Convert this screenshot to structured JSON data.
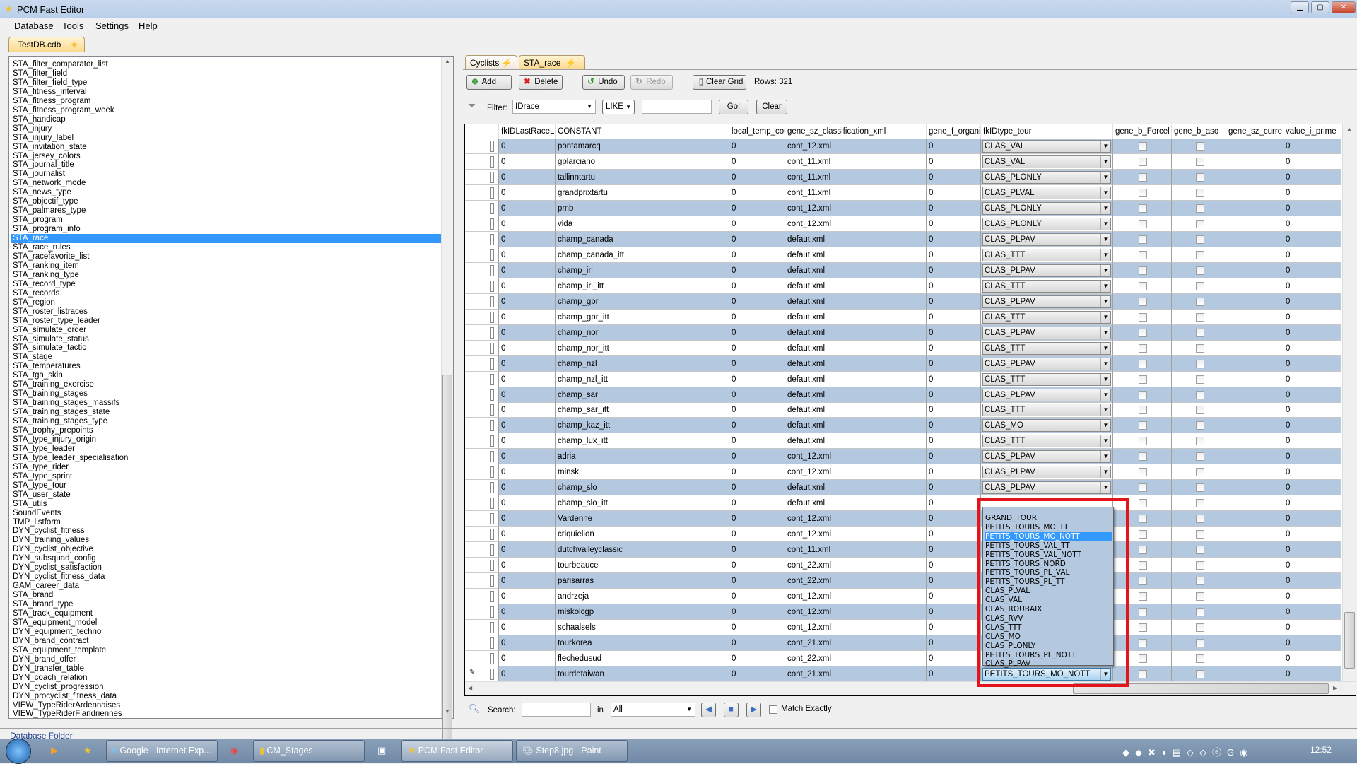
{
  "window": {
    "title": "PCM Fast Editor",
    "controls": [
      "minimize",
      "maximize",
      "close"
    ]
  },
  "menu": [
    "Database",
    "Tools",
    "Settings",
    "Help"
  ],
  "left_tab": "TestDB.cdb",
  "tables": [
    "STA_filter_comparator_list",
    "STA_filter_field",
    "STA_filter_field_type",
    "STA_fitness_interval",
    "STA_fitness_program",
    "STA_fitness_program_week",
    "STA_handicap",
    "STA_injury",
    "STA_injury_label",
    "STA_invitation_state",
    "STA_jersey_colors",
    "STA_journal_title",
    "STA_journalist",
    "STA_network_mode",
    "STA_news_type",
    "STA_objectif_type",
    "STA_palmares_type",
    "STA_program",
    "STA_program_info",
    "STA_race",
    "STA_race_rules",
    "STA_racefavorite_list",
    "STA_ranking_item",
    "STA_ranking_type",
    "STA_record_type",
    "STA_records",
    "STA_region",
    "STA_roster_listraces",
    "STA_roster_type_leader",
    "STA_simulate_order",
    "STA_simulate_status",
    "STA_simulate_tactic",
    "STA_stage",
    "STA_temperatures",
    "STA_tga_skin",
    "STA_training_exercise",
    "STA_training_stages",
    "STA_training_stages_massifs",
    "STA_training_stages_state",
    "STA_training_stages_type",
    "STA_trophy_prepoints",
    "STA_type_injury_origin",
    "STA_type_leader",
    "STA_type_leader_specialisation",
    "STA_type_rider",
    "STA_type_sprint",
    "STA_type_tour",
    "STA_user_state",
    "STA_utils",
    "SoundEvents",
    "TMP_listform",
    "DYN_cyclist_fitness",
    "DYN_training_values",
    "DYN_cyclist_objective",
    "DYN_subsquad_config",
    "DYN_cyclist_satisfaction",
    "DYN_cyclist_fitness_data",
    "GAM_career_data",
    "STA_brand",
    "STA_brand_type",
    "STA_track_equipment",
    "STA_equipment_model",
    "DYN_equipment_techno",
    "DYN_brand_contract",
    "STA_equipment_template",
    "DYN_brand_offer",
    "DYN_transfer_table",
    "DYN_coach_relation",
    "DYN_cyclist_progression",
    "DYN_procyclist_fitness_data",
    "VIEW_TypeRiderArdennaises",
    "VIEW_TypeRiderFlandriennes"
  ],
  "selected_table": "STA_race",
  "right_tabs": [
    "Cyclists",
    "STA_race"
  ],
  "toolbar": {
    "add": "Add",
    "delete": "Delete",
    "undo": "Undo",
    "redo": "Redo",
    "clear_grid": "Clear Grid",
    "rows": "Rows: 321"
  },
  "filter": {
    "label": "Filter:",
    "field": "IDrace",
    "operator": "LIKE",
    "value": "",
    "go": "Go!",
    "clear": "Clear"
  },
  "columns": [
    "fkIDLastRaceL",
    "CONSTANT",
    "local_temp_cou",
    "gene_sz_classification_xml",
    "gene_f_organis",
    "fkIDtype_tour",
    "gene_b_Forcel",
    "gene_b_aso",
    "gene_sz_curre",
    "value_i_prime"
  ],
  "rows": [
    [
      "0",
      "pontamarcq",
      "0",
      "cont_12.xml",
      "0",
      "CLAS_VAL",
      "0"
    ],
    [
      "0",
      "gplarciano",
      "0",
      "cont_11.xml",
      "0",
      "CLAS_VAL",
      "0"
    ],
    [
      "0",
      "tallinntartu",
      "0",
      "cont_11.xml",
      "0",
      "CLAS_PLONLY",
      "0"
    ],
    [
      "0",
      "grandprixtartu",
      "0",
      "cont_11.xml",
      "0",
      "CLAS_PLVAL",
      "0"
    ],
    [
      "0",
      "pmb",
      "0",
      "cont_12.xml",
      "0",
      "CLAS_PLONLY",
      "0"
    ],
    [
      "0",
      "vida",
      "0",
      "cont_12.xml",
      "0",
      "CLAS_PLONLY",
      "0"
    ],
    [
      "0",
      "champ_canada",
      "0",
      "defaut.xml",
      "0",
      "CLAS_PLPAV",
      "0"
    ],
    [
      "0",
      "champ_canada_itt",
      "0",
      "defaut.xml",
      "0",
      "CLAS_TTT",
      "0"
    ],
    [
      "0",
      "champ_irl",
      "0",
      "defaut.xml",
      "0",
      "CLAS_PLPAV",
      "0"
    ],
    [
      "0",
      "champ_irl_itt",
      "0",
      "defaut.xml",
      "0",
      "CLAS_TTT",
      "0"
    ],
    [
      "0",
      "champ_gbr",
      "0",
      "defaut.xml",
      "0",
      "CLAS_PLPAV",
      "0"
    ],
    [
      "0",
      "champ_gbr_itt",
      "0",
      "defaut.xml",
      "0",
      "CLAS_TTT",
      "0"
    ],
    [
      "0",
      "champ_nor",
      "0",
      "defaut.xml",
      "0",
      "CLAS_PLPAV",
      "0"
    ],
    [
      "0",
      "champ_nor_itt",
      "0",
      "defaut.xml",
      "0",
      "CLAS_TTT",
      "0"
    ],
    [
      "0",
      "champ_nzl",
      "0",
      "defaut.xml",
      "0",
      "CLAS_PLPAV",
      "0"
    ],
    [
      "0",
      "champ_nzl_itt",
      "0",
      "defaut.xml",
      "0",
      "CLAS_TTT",
      "0"
    ],
    [
      "0",
      "champ_sar",
      "0",
      "defaut.xml",
      "0",
      "CLAS_PLPAV",
      "0"
    ],
    [
      "0",
      "champ_sar_itt",
      "0",
      "defaut.xml",
      "0",
      "CLAS_TTT",
      "0"
    ],
    [
      "0",
      "champ_kaz_itt",
      "0",
      "defaut.xml",
      "0",
      "CLAS_MO",
      "0"
    ],
    [
      "0",
      "champ_lux_itt",
      "0",
      "defaut.xml",
      "0",
      "CLAS_TTT",
      "0"
    ],
    [
      "0",
      "adria",
      "0",
      "cont_12.xml",
      "0",
      "CLAS_PLPAV",
      "0"
    ],
    [
      "0",
      "minsk",
      "0",
      "cont_12.xml",
      "0",
      "CLAS_PLPAV",
      "0"
    ],
    [
      "0",
      "champ_slo",
      "0",
      "defaut.xml",
      "0",
      "CLAS_PLPAV",
      "0"
    ],
    [
      "0",
      "champ_slo_itt",
      "0",
      "defaut.xml",
      "0",
      "",
      "0"
    ],
    [
      "0",
      "Vardenne",
      "0",
      "cont_12.xml",
      "0",
      "",
      "0"
    ],
    [
      "0",
      "criquielion",
      "0",
      "cont_12.xml",
      "0",
      "",
      "0"
    ],
    [
      "0",
      "dutchvalleyclassic",
      "0",
      "cont_11.xml",
      "0",
      "",
      "0"
    ],
    [
      "0",
      "tourbeauce",
      "0",
      "cont_22.xml",
      "0",
      "",
      "0"
    ],
    [
      "0",
      "parisarras",
      "0",
      "cont_22.xml",
      "0",
      "",
      "0"
    ],
    [
      "0",
      "andrzeja",
      "0",
      "cont_12.xml",
      "0",
      "",
      "0"
    ],
    [
      "0",
      "miskolcgp",
      "0",
      "cont_12.xml",
      "0",
      "",
      "0"
    ],
    [
      "0",
      "schaalsels",
      "0",
      "cont_12.xml",
      "0",
      "",
      "0"
    ],
    [
      "0",
      "tourkorea",
      "0",
      "cont_21.xml",
      "0",
      "",
      "0"
    ],
    [
      "0",
      "flechedusud",
      "0",
      "cont_22.xml",
      "0",
      "",
      "0"
    ],
    [
      "0",
      "tourdetaiwan",
      "0",
      "cont_21.xml",
      "0",
      "PETITS_TOURS_MO_NOTT",
      "0"
    ]
  ],
  "dropdown": {
    "options": [
      "GRAND_TOUR",
      "PETITS_TOURS_MO_TT",
      "PETITS_TOURS_MO_NOTT",
      "PETITS_TOURS_VAL_TT",
      "PETITS_TOURS_VAL_NOTT",
      "PETITS_TOURS_NORD",
      "PETITS_TOURS_PL_VAL",
      "PETITS_TOURS_PL_TT",
      "CLAS_PLVAL",
      "CLAS_VAL",
      "CLAS_ROUBAIX",
      "CLAS_RVV",
      "CLAS_TTT",
      "CLAS_MO",
      "CLAS_PLONLY",
      "PETITS_TOURS_PL_NOTT",
      "CLAS_PLPAV"
    ],
    "selected": "PETITS_TOURS_MO_NOTT",
    "highlight_color": "#e3141c"
  },
  "search": {
    "label": "Search:",
    "value": "",
    "in_label": "in",
    "scope": "All",
    "match_exactly": "Match Exactly"
  },
  "status": "Database Folder",
  "taskbar": {
    "items": [
      "Google - Internet Exp...",
      "CM_Stages",
      "PCM Fast Editor",
      "Step8.jpg - Paint"
    ],
    "clock": "12:52"
  },
  "colors": {
    "row_alt": "#b4c8e0",
    "selection": "#3399ff"
  }
}
